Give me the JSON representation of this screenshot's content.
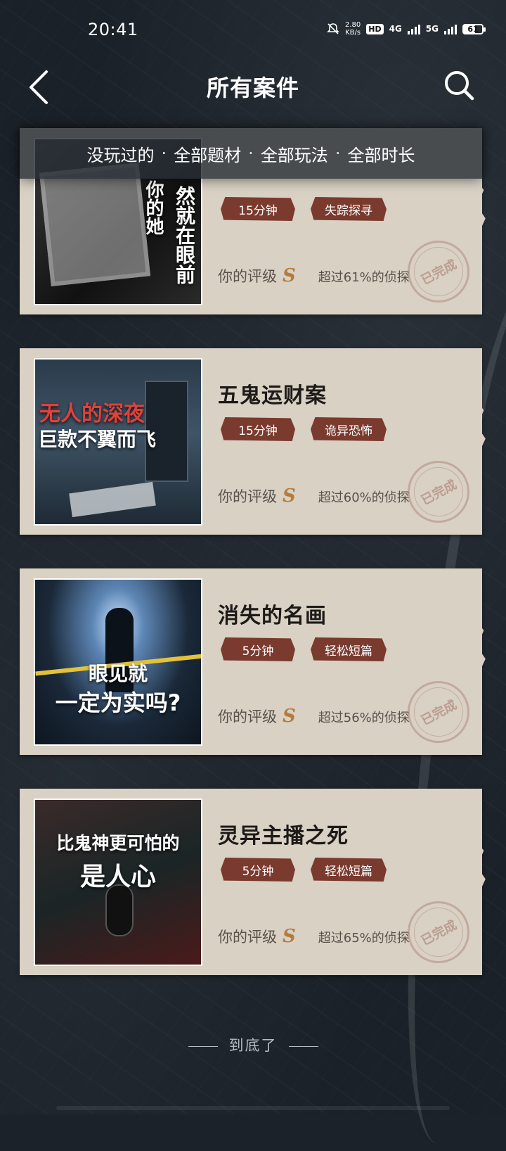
{
  "status": {
    "time": "20:41",
    "net_speed_top": "2.80",
    "net_speed_bottom": "KB/s",
    "hd": "HD",
    "sig1": "4G",
    "sig2": "5G",
    "battery": "61"
  },
  "header": {
    "title": "所有案件"
  },
  "filters": [
    "没玩过的",
    "全部题材",
    "全部玩法",
    "全部时长"
  ],
  "rating_label": "你的评级",
  "stamp_text": "已完成",
  "cases": [
    {
      "title": "",
      "duration": "15分钟",
      "genre": "失踪探寻",
      "grade": "S",
      "percent": "超过61%的侦探",
      "cover_text": [
        "你的她",
        "然就在眼前"
      ]
    },
    {
      "title": "五鬼运财案",
      "duration": "15分钟",
      "genre": "诡异恐怖",
      "grade": "S",
      "percent": "超过60%的侦探",
      "cover_text": [
        "无人的深夜",
        "巨款不翼而飞"
      ]
    },
    {
      "title": "消失的名画",
      "duration": "5分钟",
      "genre": "轻松短篇",
      "grade": "S",
      "percent": "超过56%的侦探",
      "cover_text": [
        "眼见就",
        "一定为实吗?"
      ]
    },
    {
      "title": "灵异主播之死",
      "duration": "5分钟",
      "genre": "轻松短篇",
      "grade": "S",
      "percent": "超过65%的侦探",
      "cover_text": [
        "比鬼神更可怕的",
        "是人心"
      ]
    }
  ],
  "footer": {
    "end_text": "到底了"
  }
}
